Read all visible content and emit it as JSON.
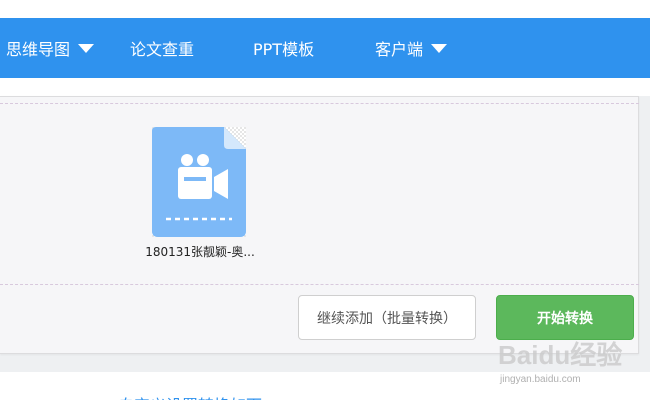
{
  "nav": {
    "items": [
      {
        "label": "思维导图",
        "has_dropdown": true
      },
      {
        "label": "论文查重",
        "has_dropdown": false
      },
      {
        "label": "PPT模板",
        "has_dropdown": false
      },
      {
        "label": "客户端",
        "has_dropdown": true
      }
    ]
  },
  "upload": {
    "file": {
      "name": "180131张靓颖-奥...",
      "icon": "video-file-icon"
    },
    "buttons": {
      "add_more": "继续添加（批量转换）",
      "start": "开始转换"
    }
  },
  "footer": {
    "partial_text": "自定义设置转换如下"
  },
  "watermark": {
    "text": "Baidu经验",
    "url_text": "jingyan.baidu.com"
  },
  "colors": {
    "nav_bg": "#2f92ee",
    "start_button": "#5cb85c",
    "file_icon": "#7db9f7"
  }
}
